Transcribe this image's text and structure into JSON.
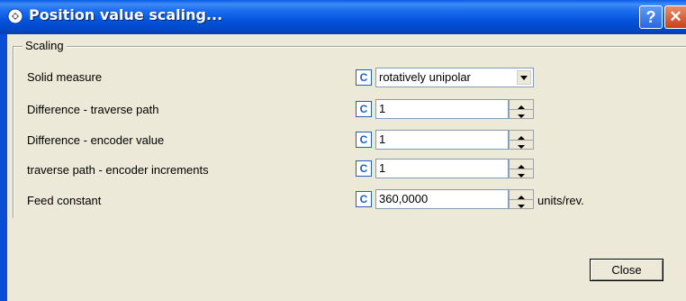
{
  "window": {
    "title": "Position value scaling...",
    "help_label": "?",
    "close_glyph": "✕"
  },
  "group": {
    "label": "Scaling"
  },
  "rows": [
    {
      "label": "Solid measure",
      "c_label": "C",
      "value": "rotatively unipolar",
      "type": "select"
    },
    {
      "label": "Difference - traverse path",
      "c_label": "C",
      "value": "1",
      "type": "spin"
    },
    {
      "label": "Difference - encoder value",
      "c_label": "C",
      "value": "1",
      "type": "spin"
    },
    {
      "label": "traverse path - encoder increments",
      "c_label": "C",
      "value": "1",
      "type": "spin"
    },
    {
      "label": "Feed constant",
      "c_label": "C",
      "value": "360,0000",
      "type": "spin",
      "units": "units/rev."
    }
  ],
  "buttons": {
    "close_label": "Close"
  },
  "colors": {
    "titlebar": "#0453DC",
    "accent_c": "#1F5FBF",
    "dialog_bg": "#ECE9D8"
  }
}
